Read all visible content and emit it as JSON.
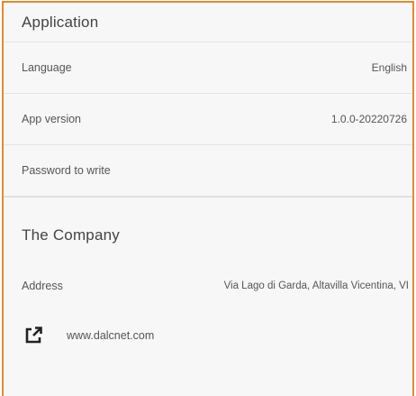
{
  "application": {
    "title": "Application",
    "rows": [
      {
        "label": "Language",
        "value": "English"
      },
      {
        "label": "App version",
        "value": "1.0.0-20220726"
      },
      {
        "label": "Password to write",
        "value": ""
      }
    ]
  },
  "company": {
    "title": "The Company",
    "address_label": "Address",
    "address_value": "Via Lago di Garda, Altavilla Vicentina, VI",
    "website": "www.dalcnet.com",
    "link_icon": "external-link-icon"
  },
  "colors": {
    "accent_border": "#e58a2e",
    "background": "#f7f7f7",
    "text": "#555555"
  }
}
